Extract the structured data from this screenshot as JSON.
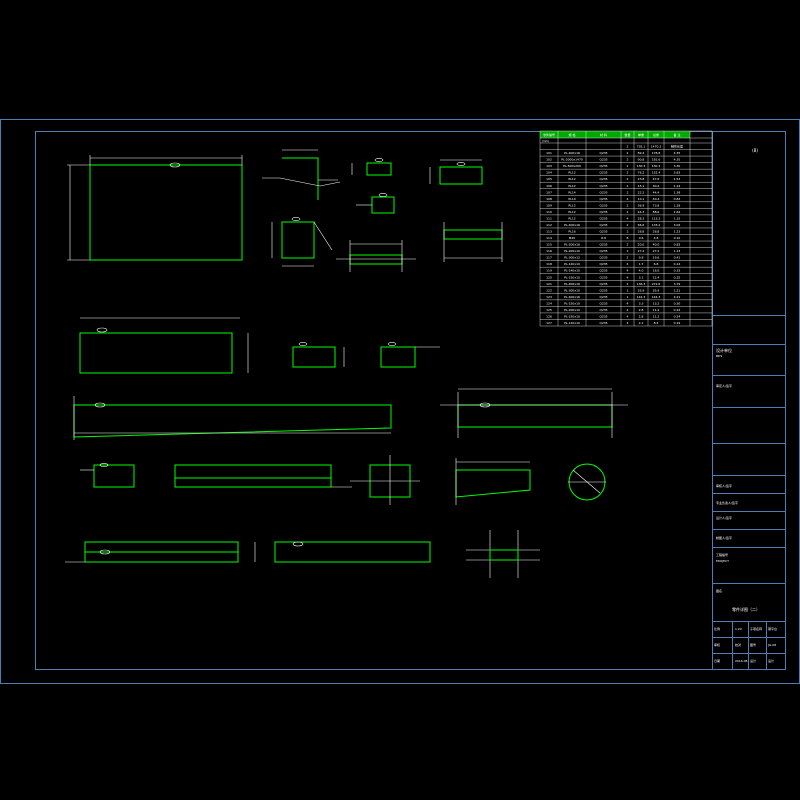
{
  "colors": {
    "background": "#000000",
    "frame": "#4a7fb5",
    "part_outline": "#00ff00",
    "dimension": "#ffffff",
    "table_header_fill": "#00aa00",
    "table_grid": "#ffffff"
  },
  "drawing": {
    "sheet_number": "(B)"
  },
  "parts_table": {
    "header": [
      "零件编号",
      "规 格",
      "材 料",
      "数量",
      "单重",
      "总重",
      "备 注"
    ],
    "subheader": "(mm)",
    "first_row": [
      "",
      "",
      "",
      "2",
      "735.1",
      "1470.2",
      "制作长度"
    ],
    "rows": [
      [
        "101",
        "PL-400x16",
        "Q235",
        "2",
        "89.4",
        "178.8",
        "4.35"
      ],
      [
        "102",
        "PL-2000x1470",
        "Q235",
        "2",
        "90.8",
        "181.6",
        "4.35"
      ],
      [
        "103",
        "PL-500x200",
        "Q235",
        "1",
        "130.3",
        "130.3",
        "3.30"
      ],
      [
        "104",
        "PL12",
        "Q235",
        "2",
        "76.2",
        "152.4",
        "3.83"
      ],
      [
        "105",
        "PL12",
        "Q235",
        "2",
        "23.8",
        "47.6",
        "1.53"
      ],
      [
        "106",
        "PL12",
        "Q235",
        "2",
        "15.1",
        "30.2",
        "1.14"
      ],
      [
        "107",
        "PL14",
        "Q235",
        "2",
        "22.2",
        "44.4",
        "1.38"
      ],
      [
        "108",
        "PL10",
        "Q235",
        "4",
        "10.1",
        "40.4",
        "0.83"
      ],
      [
        "109",
        "PL12",
        "Q235",
        "2",
        "36.9",
        "73.8",
        "1.28"
      ],
      [
        "110",
        "PL12",
        "Q235",
        "2",
        "44.3",
        "88.6",
        "1.64"
      ],
      [
        "111",
        "PL12",
        "Q235",
        "4",
        "28.3",
        "113.2",
        "1.15"
      ],
      [
        "112",
        "PL-400x16",
        "Q235",
        "2",
        "66.6",
        "133.2",
        "3.04"
      ],
      [
        "113",
        "PL16",
        "Q235",
        "1",
        "28.8",
        "28.8",
        "1.23"
      ],
      [
        "114",
        "M20",
        "8.8",
        "8",
        "0.6",
        "4.8",
        "0.10"
      ],
      [
        "115",
        "PL-200x16",
        "Q235",
        "2",
        "20.0",
        "40.0",
        "0.83"
      ],
      [
        "116",
        "PL-200x10",
        "Q235",
        "1",
        "27.2",
        "27.2",
        "1.13"
      ],
      [
        "117",
        "PL-300x12",
        "Q235",
        "2",
        "9.8",
        "19.6",
        "0.41"
      ],
      [
        "118",
        "PL-140x10",
        "Q235",
        "4",
        "1.7",
        "6.8",
        "0.14"
      ],
      [
        "119",
        "PL-140x10",
        "Q235",
        "4",
        "4.0",
        "16.0",
        "0.33"
      ],
      [
        "120",
        "PL-150x10",
        "Q235",
        "4",
        "3.1",
        "12.4",
        "0.25"
      ],
      [
        "121",
        "PL-400x16",
        "Q235",
        "2",
        "136.3",
        "272.6",
        "3.79"
      ],
      [
        "122",
        "PL-300x10",
        "Q235",
        "1",
        "35.9",
        "35.9",
        "1.21"
      ],
      [
        "123",
        "PL-400x16",
        "Q235",
        "1",
        "144.3",
        "144.3",
        "4.21"
      ],
      [
        "124",
        "PL-150x10",
        "Q235",
        "4",
        "3.3",
        "13.2",
        "0.30"
      ],
      [
        "125",
        "PL-200x10",
        "Q235",
        "4",
        "2.8",
        "11.2",
        "0.24"
      ],
      [
        "126",
        "PL-150x10",
        "Q235",
        "4",
        "2.8",
        "11.2",
        "0.24"
      ],
      [
        "127",
        "PL-120x10",
        "Q235",
        "4",
        "2.1",
        "8.4",
        "0.19"
      ]
    ]
  },
  "title_block": {
    "logo": "(B)",
    "company": "设计单位",
    "company_sub": "BDS",
    "project_name_label": "项目名称",
    "project_name": "钢结构工程",
    "item_name_label": "子项名称",
    "item_name": "钢平台",
    "professional_label": "专业负责人",
    "professional": "结构",
    "checker_label": "审核",
    "checker": "校对",
    "design_label": "设计",
    "design": "设计",
    "drawing_label": "图名",
    "drawing_title": "零件详图（二）",
    "sign1": "审定人/签字",
    "sign2": "审核人/签字",
    "sign3": "专业负责人/签字",
    "sign4": "设计人/签字",
    "sign5": "制图人/签字",
    "project_code_label": "工程编号",
    "project_code": "PROJECT",
    "scale_label": "比例",
    "scale": "1:20",
    "sheet_label": "图号",
    "sheet_no": "JG-08",
    "date_label": "日期",
    "date": "2016.08"
  }
}
